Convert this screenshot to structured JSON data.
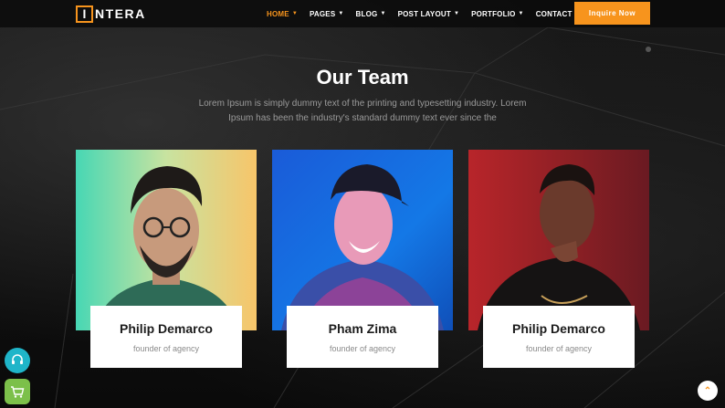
{
  "brand": {
    "logo_letter": "I",
    "logo_rest": "NTERA"
  },
  "nav": {
    "items": [
      {
        "label": "HOME",
        "active": true
      },
      {
        "label": "PAGES",
        "active": false
      },
      {
        "label": "BLOG",
        "active": false
      },
      {
        "label": "POST LAYOUT",
        "active": false
      },
      {
        "label": "PORTFOLIO",
        "active": false
      },
      {
        "label": "CONTACT US",
        "active": false
      }
    ],
    "cta_label": "Inquire Now"
  },
  "section": {
    "title": "Our Team",
    "subtitle": "Lorem Ipsum is simply dummy text of the printing and typesetting industry. Lorem Ipsum has been the industry's standard dummy text ever since the"
  },
  "team": [
    {
      "name": "Philip Demarco",
      "role": "founder of agency"
    },
    {
      "name": "Pham Zima",
      "role": "founder of agency"
    },
    {
      "name": "Philip Demarco",
      "role": "founder of agency"
    }
  ],
  "colors": {
    "accent": "#f7941d",
    "support": "#1fb5c9",
    "cart": "#7cc04a"
  },
  "widgets": {
    "support_icon": "headset-icon",
    "cart_icon": "cart-icon",
    "top_icon": "arrow-up-icon"
  }
}
